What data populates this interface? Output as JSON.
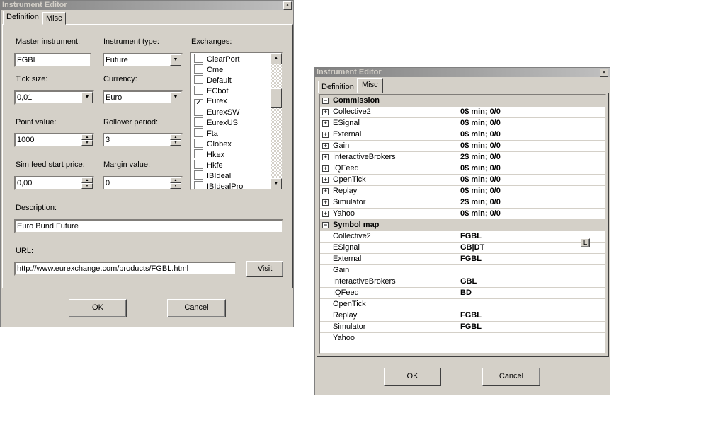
{
  "left": {
    "title": "Instrument Editor",
    "tabs": [
      "Definition",
      "Misc"
    ],
    "master_label": "Master instrument:",
    "master_value": "FGBL",
    "type_label": "Instrument type:",
    "type_value": "Future",
    "exchanges_label": "Exchanges:",
    "exchanges": [
      {
        "name": "ClearPort",
        "checked": false
      },
      {
        "name": "Cme",
        "checked": false
      },
      {
        "name": "Default",
        "checked": false
      },
      {
        "name": "ECbot",
        "checked": false
      },
      {
        "name": "Eurex",
        "checked": true
      },
      {
        "name": "EurexSW",
        "checked": false
      },
      {
        "name": "EurexUS",
        "checked": false
      },
      {
        "name": "Fta",
        "checked": false
      },
      {
        "name": "Globex",
        "checked": false
      },
      {
        "name": "Hkex",
        "checked": false
      },
      {
        "name": "Hkfe",
        "checked": false
      },
      {
        "name": "IBIdeal",
        "checked": false
      },
      {
        "name": "IBIdealPro",
        "checked": false
      }
    ],
    "tick_label": "Tick size:",
    "tick_value": "0,01",
    "currency_label": "Currency:",
    "currency_value": "Euro",
    "point_label": "Point value:",
    "point_value": "1000",
    "rollover_label": "Rollover period:",
    "rollover_value": "3",
    "sim_label": "Sim feed start price:",
    "sim_value": "0,00",
    "margin_label": "Margin value:",
    "margin_value": "0",
    "desc_label": "Description:",
    "desc_value": "Euro Bund Future",
    "url_label": "URL:",
    "url_value": "http://www.eurexchange.com/products/FGBL.html",
    "visit": "Visit",
    "ok": "OK",
    "cancel": "Cancel"
  },
  "right": {
    "title": "Instrument Editor",
    "tabs": [
      "Definition",
      "Misc"
    ],
    "commission_title": "Commission",
    "commission": [
      {
        "name": "Collective2",
        "value": "0$ min;  0/0"
      },
      {
        "name": "ESignal",
        "value": "0$ min;  0/0"
      },
      {
        "name": "External",
        "value": "0$ min;  0/0"
      },
      {
        "name": "Gain",
        "value": "0$ min;  0/0"
      },
      {
        "name": "InteractiveBrokers",
        "value": "2$ min;  0/0"
      },
      {
        "name": "IQFeed",
        "value": "0$ min;  0/0"
      },
      {
        "name": "OpenTick",
        "value": "0$ min;  0/0"
      },
      {
        "name": "Replay",
        "value": "0$ min;  0/0"
      },
      {
        "name": "Simulator",
        "value": "2$ min;  0/0"
      },
      {
        "name": "Yahoo",
        "value": "0$ min;  0/0"
      }
    ],
    "symbol_title": "Symbol map",
    "symbols": [
      {
        "name": "Collective2",
        "value": "FGBL"
      },
      {
        "name": "ESignal",
        "value": "GB|DT"
      },
      {
        "name": "External",
        "value": "FGBL"
      },
      {
        "name": "Gain",
        "value": ""
      },
      {
        "name": "InteractiveBrokers",
        "value": "GBL"
      },
      {
        "name": "IQFeed",
        "value": "BD"
      },
      {
        "name": "OpenTick",
        "value": ""
      },
      {
        "name": "Replay",
        "value": "FGBL"
      },
      {
        "name": "Simulator",
        "value": "FGBL"
      },
      {
        "name": "Yahoo",
        "value": ""
      }
    ],
    "l_button": "L",
    "ok": "OK",
    "cancel": "Cancel"
  }
}
